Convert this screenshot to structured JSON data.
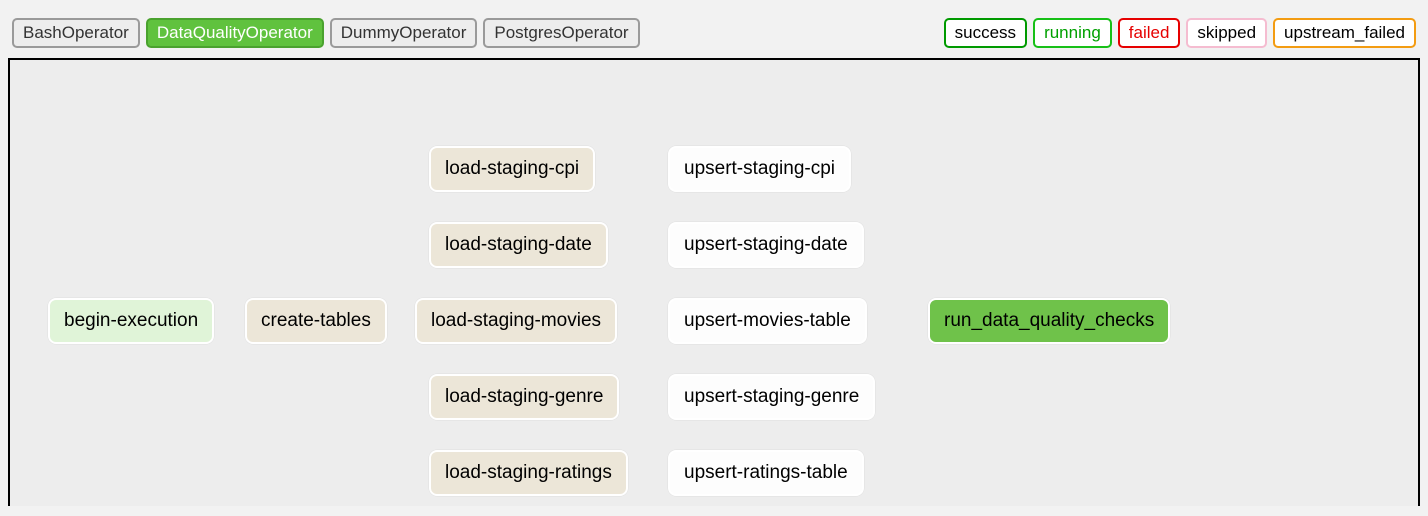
{
  "legend_operators": [
    {
      "label": "BashOperator",
      "style": "op-default"
    },
    {
      "label": "DataQualityOperator",
      "style": "op-selected"
    },
    {
      "label": "DummyOperator",
      "style": "op-default"
    },
    {
      "label": "PostgresOperator",
      "style": "op-default"
    }
  ],
  "legend_states": [
    {
      "label": "success",
      "style": "st-success"
    },
    {
      "label": "running",
      "style": "st-running"
    },
    {
      "label": "failed",
      "style": "st-failed"
    },
    {
      "label": "skipped",
      "style": "st-skipped"
    },
    {
      "label": "upstream_failed",
      "style": "st-upfail"
    }
  ],
  "nodes": {
    "begin": "begin-execution",
    "create": "create-tables",
    "ls_cpi": "load-staging-cpi",
    "ls_date": "load-staging-date",
    "ls_movies": "load-staging-movies",
    "ls_genre": "load-staging-genre",
    "ls_ratings": "load-staging-ratings",
    "up_cpi": "upsert-staging-cpi",
    "up_date": "upsert-staging-date",
    "up_movies": "upsert-movies-table",
    "up_genre": "upsert-staging-genre",
    "up_ratings": "upsert-ratings-table",
    "dq": "run_data_quality_checks"
  }
}
